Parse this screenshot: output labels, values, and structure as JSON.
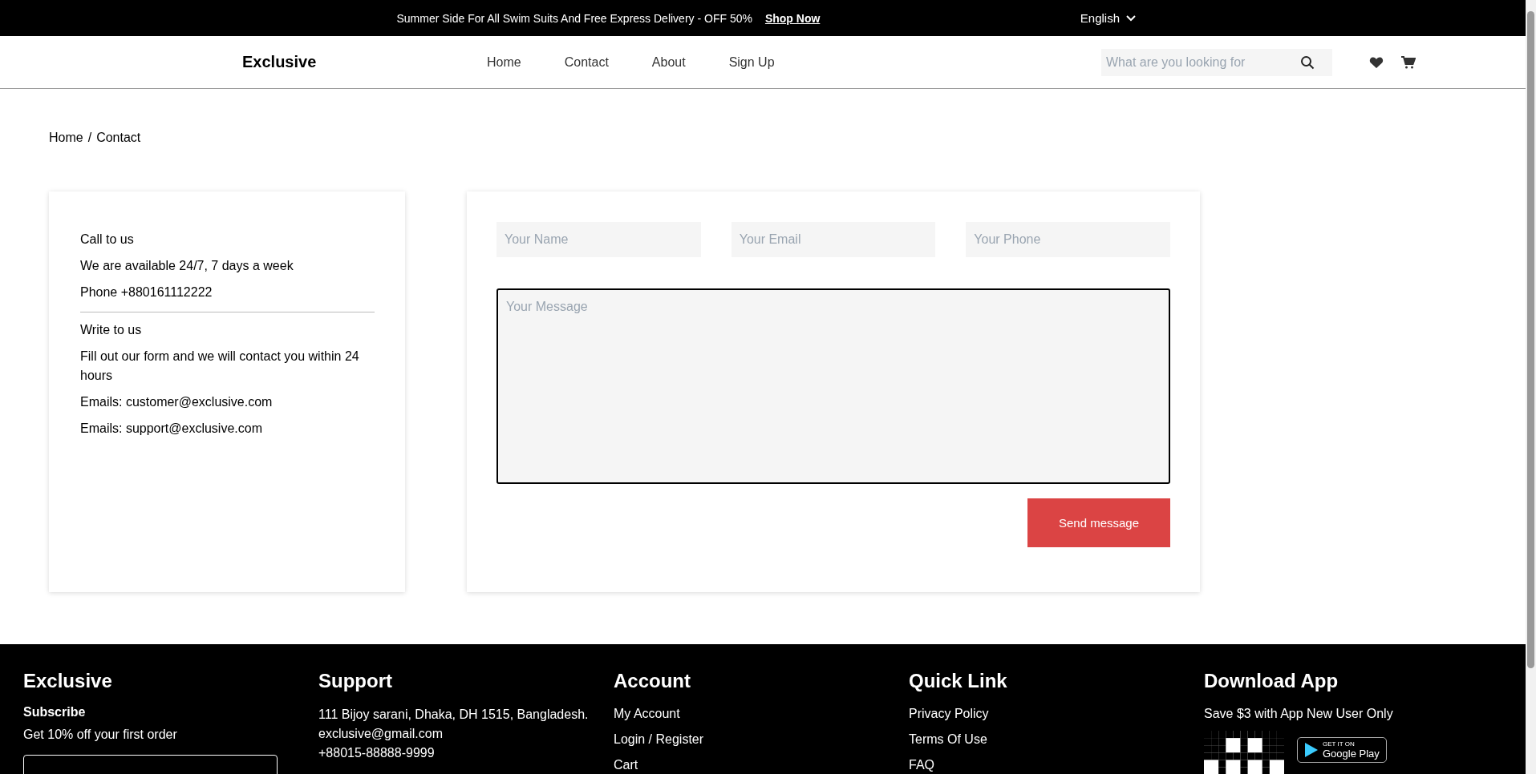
{
  "announcement": {
    "text": "Summer Side For All Swim Suits And Free Express Delivery - OFF 50%",
    "link": "Shop Now",
    "language": "English"
  },
  "header": {
    "logo": "Exclusive",
    "nav": [
      {
        "label": "Home"
      },
      {
        "label": "Contact"
      },
      {
        "label": "About"
      },
      {
        "label": "Sign Up"
      }
    ],
    "search": {
      "placeholder": "What are you looking for"
    }
  },
  "breadcrumb": {
    "items": [
      "Home",
      "Contact"
    ],
    "separator": "/"
  },
  "contact_info": {
    "call": {
      "title": "Call to us",
      "lines": [
        "We are available 24/7, 7 days a week",
        "Phone +880161112222"
      ]
    },
    "write": {
      "title": "Write to us",
      "lines": [
        "Fill out our form and we will contact you within 24 hours",
        "Emails: customer@exclusive.com",
        "Emails: support@exclusive.com"
      ]
    }
  },
  "form": {
    "fields": [
      {
        "placeholder": "Your Name"
      },
      {
        "placeholder": "Your Email"
      },
      {
        "placeholder": "Your Phone"
      }
    ],
    "message": {
      "placeholder": "Your Message"
    },
    "submit": "Send message"
  },
  "footer": {
    "columns": [
      {
        "title": "Exclusive",
        "kind": "subscribe",
        "subtitle": "Subscribe",
        "lines": [
          "Get 10% off your first order"
        ]
      },
      {
        "title": "Support",
        "kind": "text",
        "lines": [
          "111 Bijoy sarani, Dhaka, DH 1515, Bangladesh.",
          "exclusive@gmail.com",
          "+88015-88888-9999"
        ]
      },
      {
        "title": "Account",
        "kind": "links",
        "lines": [
          "My Account",
          "Login / Register",
          "Cart"
        ]
      },
      {
        "title": "Quick Link",
        "kind": "links",
        "lines": [
          "Privacy Policy",
          "Terms Of Use",
          "FAQ"
        ]
      },
      {
        "title": "Download App",
        "kind": "app",
        "lines": [
          "Save $3 with App New User Only"
        ],
        "badge": {
          "small": "GET IT ON",
          "big": "Google Play"
        }
      }
    ]
  }
}
